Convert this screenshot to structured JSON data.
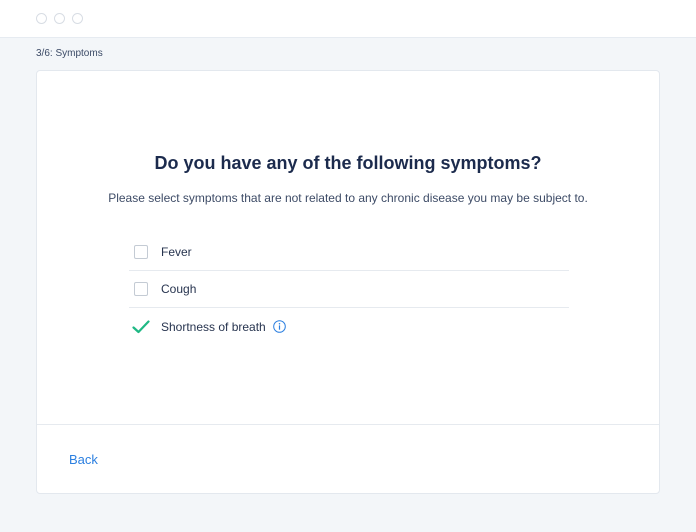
{
  "window": {
    "controls": [
      "circle",
      "circle",
      "circle"
    ]
  },
  "step": {
    "label": "3/6: Symptoms"
  },
  "question": {
    "title": "Do you have any of the following symptoms?",
    "subtitle": "Please select symptoms that are not related to any chronic disease you may be subject to."
  },
  "options": [
    {
      "label": "Fever",
      "checked": false
    },
    {
      "label": "Cough",
      "checked": false
    },
    {
      "label": "Shortness of breath",
      "checked": true,
      "icon": "info-icon"
    }
  ],
  "footer": {
    "back_label": "Back"
  },
  "colors": {
    "accent": "#2b7fe0",
    "check": "#1fb884",
    "title": "#1c2b4d"
  }
}
